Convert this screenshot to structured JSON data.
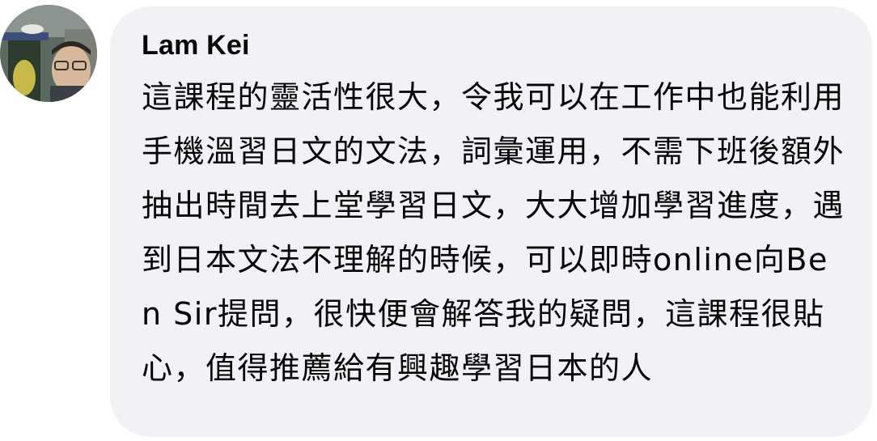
{
  "comment": {
    "author": "Lam Kei",
    "text": "這課程的靈活性很大，令我可以在工作中也能利用手機溫習日文的文法，詞彙運用，不需下班後額外抽出時間去上堂學習日文，大大增加學習進度，遇到日本文法不理解的時候，可以即時online向Ben Sir提問，很快便會解答我的疑問，這課程很貼心，值得推薦給有興趣學習日本的人",
    "avatar": "profile-photo"
  },
  "colors": {
    "bubble_background": "#f0f2f5",
    "text": "#050505"
  }
}
